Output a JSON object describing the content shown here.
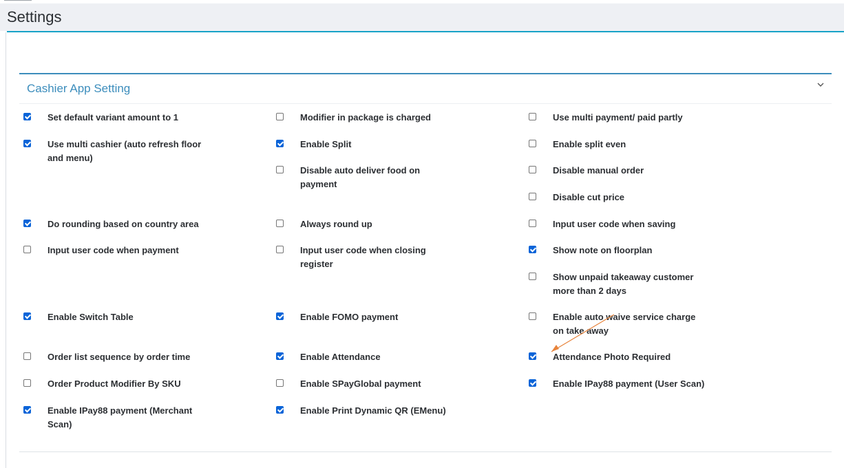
{
  "page": {
    "title": "Settings"
  },
  "card": {
    "title": "Cashier App Setting",
    "collapse_icon": "chevron-down-icon"
  },
  "colors": {
    "accent": "#3c8dbc",
    "header_line": "#17a2c7",
    "checked": "#0a64d8",
    "annotation_arrow": "#e8843c"
  },
  "settings": [
    {
      "label": "Set default variant amount to 1",
      "checked": true
    },
    {
      "label": "Modifier in package is charged",
      "checked": false
    },
    {
      "label": "Use multi payment/ paid partly",
      "checked": false
    },
    {
      "label": "Use multi cashier (auto refresh floor and menu)",
      "checked": true
    },
    {
      "label": "Enable Split",
      "checked": true
    },
    {
      "label": "Enable split even",
      "checked": false
    },
    {
      "label": "Disable auto deliver food on payment",
      "checked": false
    },
    {
      "label": "Disable manual order",
      "checked": false
    },
    {
      "label": "Disable cut price",
      "checked": false
    },
    {
      "label": "Do rounding based on country area",
      "checked": true
    },
    {
      "label": "Always round up",
      "checked": false
    },
    {
      "label": "Input user code when saving",
      "checked": false
    },
    {
      "label": "Input user code when payment",
      "checked": false
    },
    {
      "label": "Input user code when closing register",
      "checked": false
    },
    {
      "label": "Show note on floorplan",
      "checked": true
    },
    {
      "label": "Show unpaid takeaway customer more than 2 days",
      "checked": false
    },
    {
      "label": "Enable Switch Table",
      "checked": true
    },
    {
      "label": "Enable FOMO payment",
      "checked": true
    },
    {
      "label": "Enable auto waive service charge on take away",
      "checked": false
    },
    {
      "label": "Order list sequence by order time",
      "checked": false
    },
    {
      "label": "Enable Attendance",
      "checked": true
    },
    {
      "label": "Attendance Photo Required",
      "checked": true
    },
    {
      "label": "Order Product Modifier By SKU",
      "checked": false
    },
    {
      "label": "Enable SPayGlobal payment",
      "checked": false
    },
    {
      "label": "Enable IPay88 payment (User Scan)",
      "checked": true
    },
    {
      "label": "Enable IPay88 payment (Merchant Scan)",
      "checked": true
    },
    {
      "label": "Enable Print Dynamic QR (EMenu)",
      "checked": true
    }
  ]
}
